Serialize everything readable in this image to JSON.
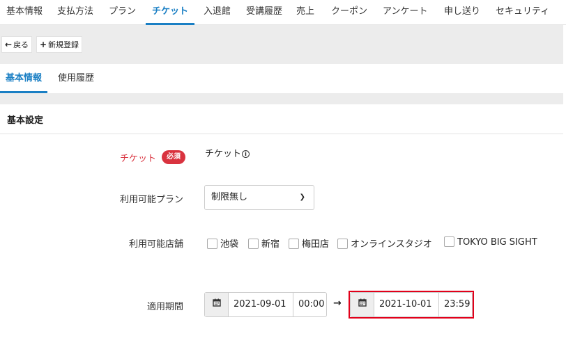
{
  "topnav": {
    "tabs": [
      {
        "label": "基本情報"
      },
      {
        "label": "支払方法"
      },
      {
        "label": "プラン"
      },
      {
        "label": "チケット",
        "active": true
      },
      {
        "label": "入退館"
      },
      {
        "label": "受講履歴"
      },
      {
        "label": "売上"
      },
      {
        "label": "クーポン"
      },
      {
        "label": "アンケート"
      },
      {
        "label": "申し送り"
      },
      {
        "label": "セキュリティ"
      }
    ]
  },
  "toolbar": {
    "back_label": "戻る",
    "new_label": "新規登録"
  },
  "subtabs": [
    {
      "label": "基本情報",
      "active": true
    },
    {
      "label": "使用履歴"
    }
  ],
  "section": {
    "title": "基本設定"
  },
  "form": {
    "ticket": {
      "label": "チケット",
      "required_badge": "必須",
      "value": "チケット",
      "info_icon": "ⓘ"
    },
    "plan": {
      "label": "利用可能プラン",
      "selected": "制限無し"
    },
    "stores": {
      "label": "利用可能店舗",
      "options": [
        {
          "label": "池袋",
          "checked": false
        },
        {
          "label": "新宿",
          "checked": false
        },
        {
          "label": "梅田店",
          "checked": false
        },
        {
          "label": "オンラインスタジオ",
          "checked": false
        },
        {
          "label": "TOKYO BIG SIGHT",
          "checked": false
        }
      ]
    },
    "period": {
      "label": "適用期間",
      "start_date": "2021-09-01",
      "start_time": "00:00",
      "end_date": "2021-10-01",
      "end_time": "23:59"
    }
  },
  "colors": {
    "accent": "#1a7fc4",
    "required": "#d9333f",
    "highlight": "#e2001a",
    "toolbar_bg": "#ececec"
  }
}
